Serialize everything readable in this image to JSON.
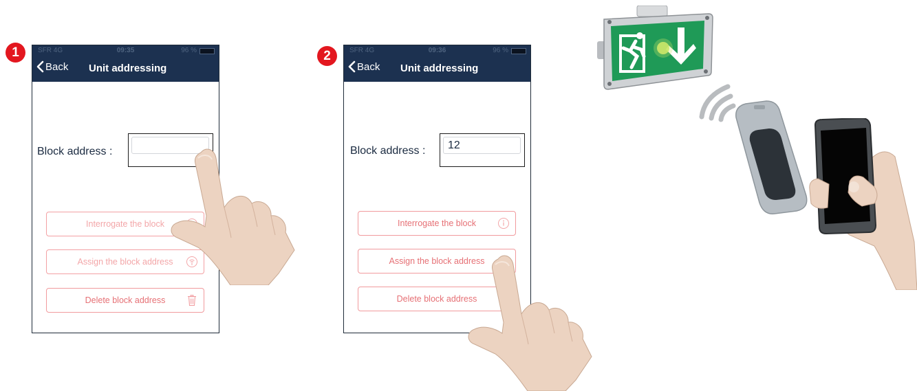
{
  "steps": [
    {
      "number": "1",
      "status": {
        "carrier": "SFR  4G",
        "time": "09:35",
        "battery": "96 %"
      },
      "nav": {
        "back_label": "Back",
        "title": "Unit addressing"
      },
      "address": {
        "label": "Block address :",
        "value": ""
      },
      "buttons": {
        "interrogate": "Interrogate the block",
        "assign": "Assign the block address",
        "delete": "Delete block address"
      }
    },
    {
      "number": "2",
      "status": {
        "carrier": "SFR  4G",
        "time": "09:36",
        "battery": "96 %"
      },
      "nav": {
        "back_label": "Back",
        "title": "Unit addressing"
      },
      "address": {
        "label": "Block address :",
        "value": "12"
      },
      "buttons": {
        "interrogate": "Interrogate the block",
        "assign": "Assign the block address",
        "delete": "Delete block address"
      }
    }
  ],
  "icons": {
    "back": "chevron-left-icon",
    "info": "info-icon",
    "transmit": "transmit-icon",
    "delete": "trash-icon",
    "exit_sign": "running-man-exit-icon",
    "wireless": "wireless-signal-icon"
  },
  "colors": {
    "nav_bar": "#1c3150",
    "badge": "#e3171f",
    "button_border": "#f3a0a3",
    "sign_green": "#1f9a57"
  }
}
